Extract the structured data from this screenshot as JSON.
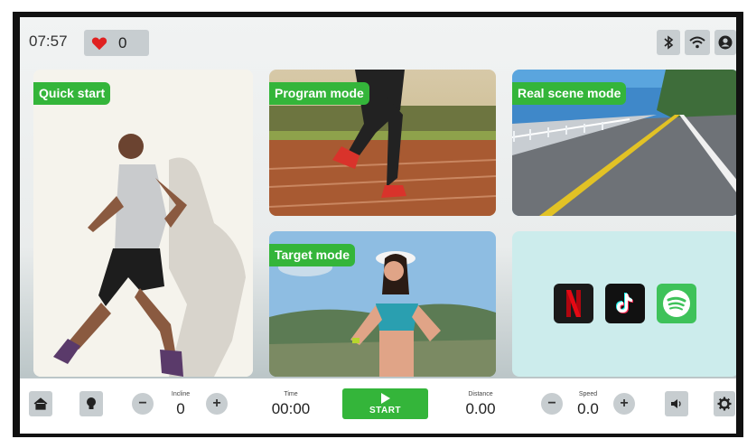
{
  "status_bar": {
    "time": "07:57",
    "heart_rate": "0",
    "icons": [
      "bluetooth-icon",
      "wifi-icon",
      "user-icon"
    ]
  },
  "modes": [
    {
      "id": "quick-start",
      "label": "Quick start"
    },
    {
      "id": "program-mode",
      "label": "Program mode"
    },
    {
      "id": "real-scene-mode",
      "label": "Real scene mode"
    },
    {
      "id": "target-mode",
      "label": "Target mode"
    }
  ],
  "apps": [
    {
      "name": "Netflix",
      "icon": "netflix-icon",
      "color": "#1a1a1a"
    },
    {
      "name": "TikTok",
      "icon": "tiktok-icon",
      "color": "#111111"
    },
    {
      "name": "Spotify",
      "icon": "spotify-icon",
      "color": "#3ec25a"
    }
  ],
  "controls": {
    "incline": {
      "label": "Incline",
      "value": "0"
    },
    "time": {
      "label": "Time",
      "value": "00:00"
    },
    "start_label": "START",
    "distance": {
      "label": "Distance",
      "value": "0.00"
    },
    "speed": {
      "label": "Speed",
      "value": "0.0"
    },
    "minus": "−",
    "plus": "+"
  },
  "colors": {
    "accent": "#34b53a",
    "button_bg": "#c7cdd0",
    "heart": "#e02020"
  }
}
